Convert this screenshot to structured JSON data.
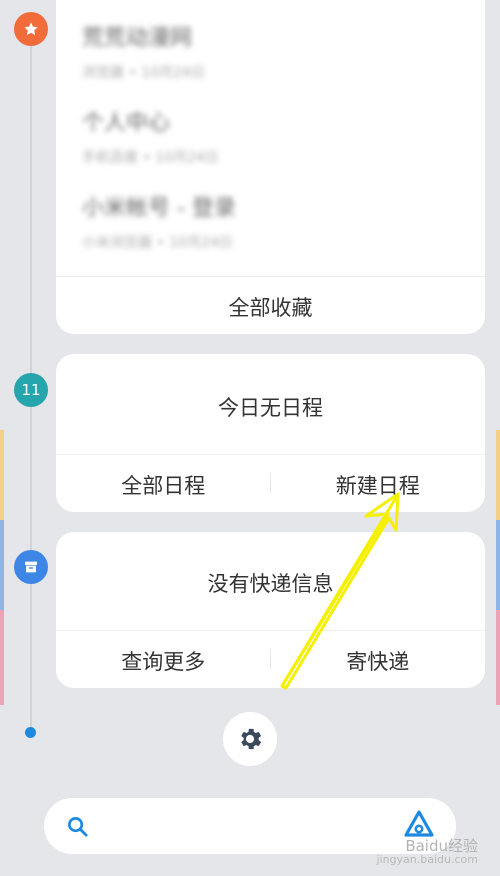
{
  "favorites": {
    "items": [
      {
        "title": "荒荒动漫网",
        "subtitle": "浏览器 • 10月24日"
      },
      {
        "title": "个人中心",
        "subtitle": "手机百度 • 10月24日"
      },
      {
        "title": "小米帐号 - 登录",
        "subtitle": "小米浏览器 • 10月24日"
      }
    ],
    "all_label": "全部收藏"
  },
  "calendar": {
    "day": "11",
    "empty_text": "今日无日程",
    "all_label": "全部日程",
    "new_label": "新建日程"
  },
  "express": {
    "empty_text": "没有快递信息",
    "query_label": "查询更多",
    "send_label": "寄快递"
  },
  "search": {
    "placeholder": ""
  },
  "watermark": {
    "brand": "Baidu经验",
    "url": "jingyan.baidu.com"
  },
  "colors": {
    "favorites_node": "#f26b3a",
    "calendar_node": "#27a5ac",
    "express_node": "#3d86e6",
    "accent_blue": "#1d8ae0",
    "arrow": "#f4f000"
  },
  "icons": {
    "favorites": "star-icon",
    "express": "box-icon",
    "settings": "gear-icon",
    "search": "search-icon",
    "assistant": "triangle-logo-icon"
  }
}
